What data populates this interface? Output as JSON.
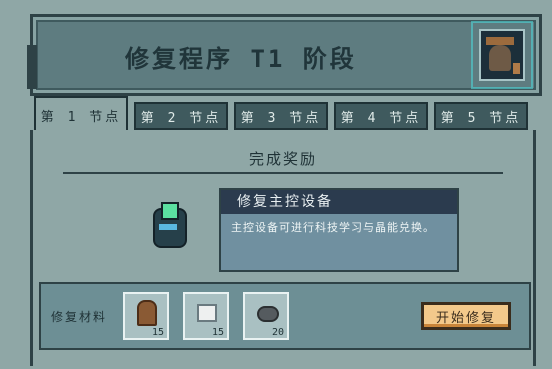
{
  "header": {
    "title": "修复程序 T1 阶段",
    "portrait_icon": "well-portrait-icon"
  },
  "tabs": [
    {
      "label": "第 1 节点",
      "active": true
    },
    {
      "label": "第 2 节点",
      "active": false
    },
    {
      "label": "第 3 节点",
      "active": false
    },
    {
      "label": "第 4 节点",
      "active": false
    },
    {
      "label": "第 5 节点",
      "active": false
    }
  ],
  "reward": {
    "title": "完成奖励",
    "item_name": "修复主控设备",
    "item_desc": "主控设备可进行科技学习与晶能兑换。",
    "item_icon": "control-device-icon"
  },
  "materials": {
    "label": "修复材料",
    "items": [
      {
        "icon": "wood-log-icon",
        "count": "15"
      },
      {
        "icon": "paper-icon",
        "count": "15"
      },
      {
        "icon": "ore-icon",
        "count": "20"
      }
    ],
    "start_label": "开始修复"
  }
}
